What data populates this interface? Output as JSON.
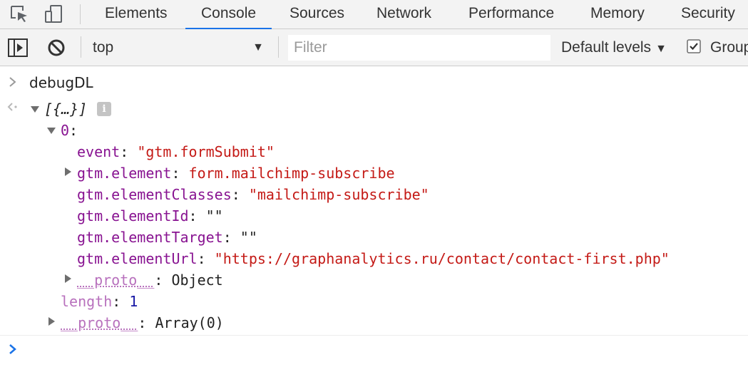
{
  "tabs": [
    {
      "label": "Elements",
      "active": false
    },
    {
      "label": "Console",
      "active": true
    },
    {
      "label": "Sources",
      "active": false
    },
    {
      "label": "Network",
      "active": false
    },
    {
      "label": "Performance",
      "active": false
    },
    {
      "label": "Memory",
      "active": false
    },
    {
      "label": "Security",
      "active": false
    }
  ],
  "toolbar": {
    "context": "top",
    "filter_placeholder": "Filter",
    "levels": "Default levels",
    "group_label": "Group",
    "group_checked": true
  },
  "console": {
    "input_command": "debugDL",
    "result_summary": "[{…}]",
    "item_index": "0",
    "props": [
      {
        "key": "event",
        "value": "\"gtm.formSubmit\"",
        "type": "string",
        "expandable": false
      },
      {
        "key": "gtm.element",
        "value": "form.mailchimp-subscribe",
        "type": "string",
        "expandable": true
      },
      {
        "key": "gtm.elementClasses",
        "value": "\"mailchimp-subscribe\"",
        "type": "string",
        "expandable": false
      },
      {
        "key": "gtm.elementId",
        "value": "\"\"",
        "type": "plain",
        "expandable": false
      },
      {
        "key": "gtm.elementTarget",
        "value": "\"\"",
        "type": "plain",
        "expandable": false
      },
      {
        "key": "gtm.elementUrl",
        "value": "\"https://graphanalytics.ru/contact/contact-first.php\"",
        "type": "string",
        "expandable": false
      }
    ],
    "item_proto_key": "__proto__",
    "item_proto_value": "Object",
    "length_key": "length",
    "length_value": "1",
    "array_proto_key": "__proto__",
    "array_proto_value": "Array(0)"
  },
  "colors": {
    "accent": "#1a73e8",
    "key": "#881391",
    "string": "#c41a16",
    "number": "#1a1aa6"
  }
}
